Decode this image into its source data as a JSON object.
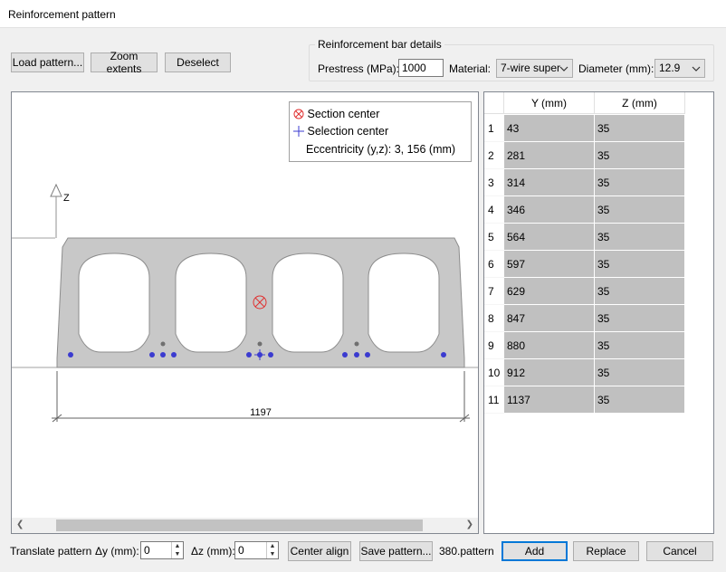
{
  "window": {
    "title": "Reinforcement pattern"
  },
  "toolbar": {
    "load_pattern": "Load pattern...",
    "zoom_extents": "Zoom extents",
    "deselect": "Deselect"
  },
  "bar_details": {
    "legend": "Reinforcement bar details",
    "prestress_label": "Prestress (MPa):",
    "prestress_value": "1000",
    "material_label": "Material:",
    "material_value": "7-wire super",
    "diameter_label": "Diameter (mm):",
    "diameter_value": "12.9"
  },
  "canvas": {
    "legend": {
      "section_center": "Section center",
      "selection_center": "Selection center",
      "eccentricity": "Eccentricity (y,z): 3, 156 (mm)"
    },
    "axis_label": "Z",
    "dimension": "1197"
  },
  "table": {
    "columns": [
      "Y (mm)",
      "Z (mm)"
    ],
    "rows": [
      {
        "index": "1",
        "y": "43",
        "z": "35"
      },
      {
        "index": "2",
        "y": "281",
        "z": "35"
      },
      {
        "index": "3",
        "y": "314",
        "z": "35"
      },
      {
        "index": "4",
        "y": "346",
        "z": "35"
      },
      {
        "index": "5",
        "y": "564",
        "z": "35"
      },
      {
        "index": "6",
        "y": "597",
        "z": "35"
      },
      {
        "index": "7",
        "y": "629",
        "z": "35"
      },
      {
        "index": "8",
        "y": "847",
        "z": "35"
      },
      {
        "index": "9",
        "y": "880",
        "z": "35"
      },
      {
        "index": "10",
        "y": "912",
        "z": "35"
      },
      {
        "index": "11",
        "y": "1137",
        "z": "35"
      }
    ]
  },
  "bottom": {
    "translate_label": "Translate pattern",
    "dy_label": "Δy (mm):",
    "dy_value": "0",
    "dz_label": "Δz (mm):",
    "dz_value": "0",
    "center_align": "Center align",
    "save_pattern": "Save pattern...",
    "filename": "380.pattern",
    "add": "Add",
    "replace": "Replace",
    "cancel": "Cancel"
  },
  "colors": {
    "accent": "#0078d7",
    "strand": "#3b3bd0",
    "section_center": "#e03030",
    "concrete": "#c8c8c8"
  }
}
